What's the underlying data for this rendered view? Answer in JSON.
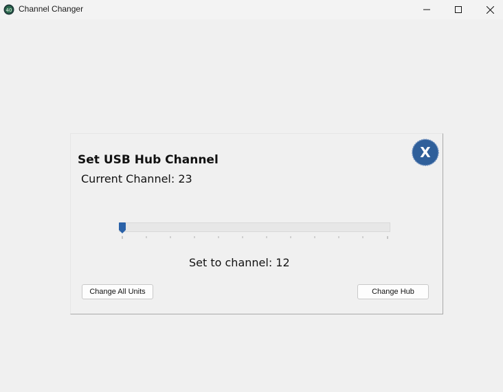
{
  "window": {
    "title": "Channel Changer",
    "icon": "app-logo-icon"
  },
  "dialog": {
    "title": "Set USB Hub Channel",
    "current_channel": "Current Channel: 23",
    "set_channel": "Set to channel: 12",
    "close_label": "X",
    "slider": {
      "min": 12,
      "max": 23,
      "value": 12
    },
    "buttons": {
      "change_all": "Change All Units",
      "change_hub": "Change Hub"
    }
  },
  "colors": {
    "accent": "#2b62a8",
    "close_circle": "#2f5f9a",
    "window_bg": "#f0f0f0"
  }
}
